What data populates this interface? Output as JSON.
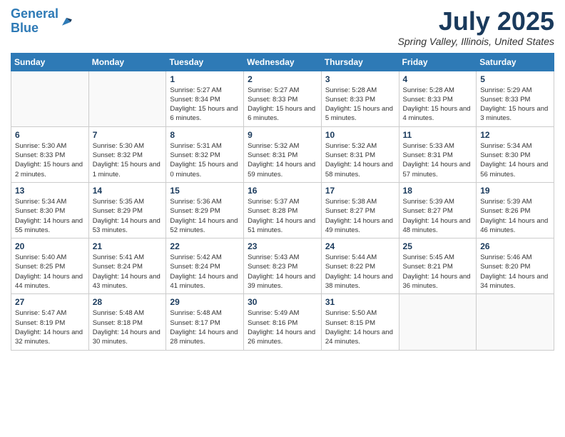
{
  "header": {
    "logo_line1": "General",
    "logo_line2": "Blue",
    "title": "July 2025",
    "subtitle": "Spring Valley, Illinois, United States"
  },
  "days_of_week": [
    "Sunday",
    "Monday",
    "Tuesday",
    "Wednesday",
    "Thursday",
    "Friday",
    "Saturday"
  ],
  "weeks": [
    [
      {
        "day": "",
        "empty": true
      },
      {
        "day": "",
        "empty": true
      },
      {
        "day": "1",
        "sunrise": "Sunrise: 5:27 AM",
        "sunset": "Sunset: 8:34 PM",
        "daylight": "Daylight: 15 hours and 6 minutes."
      },
      {
        "day": "2",
        "sunrise": "Sunrise: 5:27 AM",
        "sunset": "Sunset: 8:33 PM",
        "daylight": "Daylight: 15 hours and 6 minutes."
      },
      {
        "day": "3",
        "sunrise": "Sunrise: 5:28 AM",
        "sunset": "Sunset: 8:33 PM",
        "daylight": "Daylight: 15 hours and 5 minutes."
      },
      {
        "day": "4",
        "sunrise": "Sunrise: 5:28 AM",
        "sunset": "Sunset: 8:33 PM",
        "daylight": "Daylight: 15 hours and 4 minutes."
      },
      {
        "day": "5",
        "sunrise": "Sunrise: 5:29 AM",
        "sunset": "Sunset: 8:33 PM",
        "daylight": "Daylight: 15 hours and 3 minutes."
      }
    ],
    [
      {
        "day": "6",
        "sunrise": "Sunrise: 5:30 AM",
        "sunset": "Sunset: 8:33 PM",
        "daylight": "Daylight: 15 hours and 2 minutes."
      },
      {
        "day": "7",
        "sunrise": "Sunrise: 5:30 AM",
        "sunset": "Sunset: 8:32 PM",
        "daylight": "Daylight: 15 hours and 1 minute."
      },
      {
        "day": "8",
        "sunrise": "Sunrise: 5:31 AM",
        "sunset": "Sunset: 8:32 PM",
        "daylight": "Daylight: 15 hours and 0 minutes."
      },
      {
        "day": "9",
        "sunrise": "Sunrise: 5:32 AM",
        "sunset": "Sunset: 8:31 PM",
        "daylight": "Daylight: 14 hours and 59 minutes."
      },
      {
        "day": "10",
        "sunrise": "Sunrise: 5:32 AM",
        "sunset": "Sunset: 8:31 PM",
        "daylight": "Daylight: 14 hours and 58 minutes."
      },
      {
        "day": "11",
        "sunrise": "Sunrise: 5:33 AM",
        "sunset": "Sunset: 8:31 PM",
        "daylight": "Daylight: 14 hours and 57 minutes."
      },
      {
        "day": "12",
        "sunrise": "Sunrise: 5:34 AM",
        "sunset": "Sunset: 8:30 PM",
        "daylight": "Daylight: 14 hours and 56 minutes."
      }
    ],
    [
      {
        "day": "13",
        "sunrise": "Sunrise: 5:34 AM",
        "sunset": "Sunset: 8:30 PM",
        "daylight": "Daylight: 14 hours and 55 minutes."
      },
      {
        "day": "14",
        "sunrise": "Sunrise: 5:35 AM",
        "sunset": "Sunset: 8:29 PM",
        "daylight": "Daylight: 14 hours and 53 minutes."
      },
      {
        "day": "15",
        "sunrise": "Sunrise: 5:36 AM",
        "sunset": "Sunset: 8:29 PM",
        "daylight": "Daylight: 14 hours and 52 minutes."
      },
      {
        "day": "16",
        "sunrise": "Sunrise: 5:37 AM",
        "sunset": "Sunset: 8:28 PM",
        "daylight": "Daylight: 14 hours and 51 minutes."
      },
      {
        "day": "17",
        "sunrise": "Sunrise: 5:38 AM",
        "sunset": "Sunset: 8:27 PM",
        "daylight": "Daylight: 14 hours and 49 minutes."
      },
      {
        "day": "18",
        "sunrise": "Sunrise: 5:39 AM",
        "sunset": "Sunset: 8:27 PM",
        "daylight": "Daylight: 14 hours and 48 minutes."
      },
      {
        "day": "19",
        "sunrise": "Sunrise: 5:39 AM",
        "sunset": "Sunset: 8:26 PM",
        "daylight": "Daylight: 14 hours and 46 minutes."
      }
    ],
    [
      {
        "day": "20",
        "sunrise": "Sunrise: 5:40 AM",
        "sunset": "Sunset: 8:25 PM",
        "daylight": "Daylight: 14 hours and 44 minutes."
      },
      {
        "day": "21",
        "sunrise": "Sunrise: 5:41 AM",
        "sunset": "Sunset: 8:24 PM",
        "daylight": "Daylight: 14 hours and 43 minutes."
      },
      {
        "day": "22",
        "sunrise": "Sunrise: 5:42 AM",
        "sunset": "Sunset: 8:24 PM",
        "daylight": "Daylight: 14 hours and 41 minutes."
      },
      {
        "day": "23",
        "sunrise": "Sunrise: 5:43 AM",
        "sunset": "Sunset: 8:23 PM",
        "daylight": "Daylight: 14 hours and 39 minutes."
      },
      {
        "day": "24",
        "sunrise": "Sunrise: 5:44 AM",
        "sunset": "Sunset: 8:22 PM",
        "daylight": "Daylight: 14 hours and 38 minutes."
      },
      {
        "day": "25",
        "sunrise": "Sunrise: 5:45 AM",
        "sunset": "Sunset: 8:21 PM",
        "daylight": "Daylight: 14 hours and 36 minutes."
      },
      {
        "day": "26",
        "sunrise": "Sunrise: 5:46 AM",
        "sunset": "Sunset: 8:20 PM",
        "daylight": "Daylight: 14 hours and 34 minutes."
      }
    ],
    [
      {
        "day": "27",
        "sunrise": "Sunrise: 5:47 AM",
        "sunset": "Sunset: 8:19 PM",
        "daylight": "Daylight: 14 hours and 32 minutes."
      },
      {
        "day": "28",
        "sunrise": "Sunrise: 5:48 AM",
        "sunset": "Sunset: 8:18 PM",
        "daylight": "Daylight: 14 hours and 30 minutes."
      },
      {
        "day": "29",
        "sunrise": "Sunrise: 5:48 AM",
        "sunset": "Sunset: 8:17 PM",
        "daylight": "Daylight: 14 hours and 28 minutes."
      },
      {
        "day": "30",
        "sunrise": "Sunrise: 5:49 AM",
        "sunset": "Sunset: 8:16 PM",
        "daylight": "Daylight: 14 hours and 26 minutes."
      },
      {
        "day": "31",
        "sunrise": "Sunrise: 5:50 AM",
        "sunset": "Sunset: 8:15 PM",
        "daylight": "Daylight: 14 hours and 24 minutes."
      },
      {
        "day": "",
        "empty": true
      },
      {
        "day": "",
        "empty": true
      }
    ]
  ]
}
